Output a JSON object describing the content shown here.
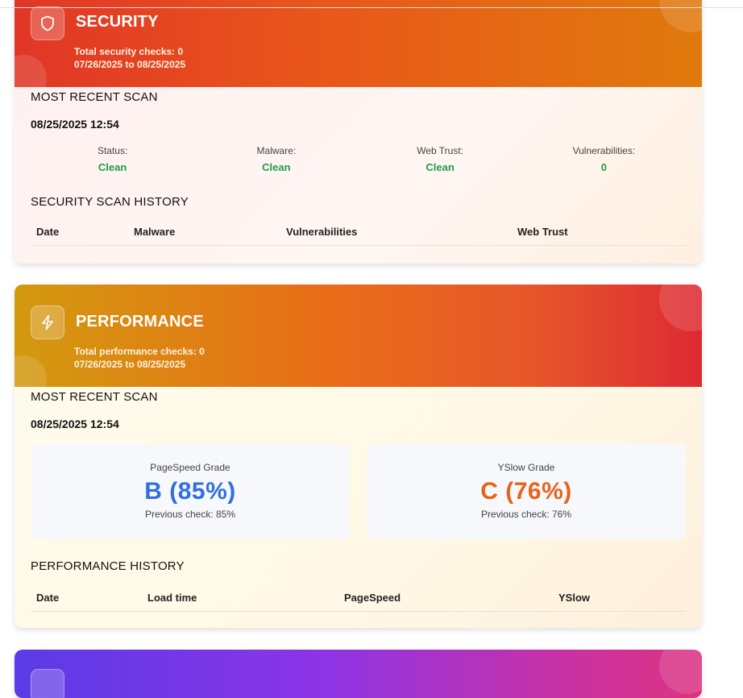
{
  "security": {
    "title": "SECURITY",
    "total_checks": "Total security checks: 0",
    "date_range": "07/26/2025 to 08/25/2025",
    "most_recent_label": "MOST RECENT SCAN",
    "scan_time": "08/25/2025 12:54",
    "stats": [
      {
        "label": "Status:",
        "value": "Clean"
      },
      {
        "label": "Malware:",
        "value": "Clean"
      },
      {
        "label": "Web Trust:",
        "value": "Clean"
      },
      {
        "label": "Vulnerabilities:",
        "value": "0"
      }
    ],
    "history_label": "SECURITY SCAN HISTORY",
    "history_columns": [
      "Date",
      "Malware",
      "Vulnerabilities",
      "Web Trust"
    ]
  },
  "performance": {
    "title": "PERFORMANCE",
    "total_checks": "Total performance checks: 0",
    "date_range": "07/26/2025 to 08/25/2025",
    "most_recent_label": "MOST RECENT SCAN",
    "scan_time": "08/25/2025 12:54",
    "pagespeed": {
      "label": "PageSpeed Grade",
      "value": "B (85%)",
      "previous": "Previous check: 85%",
      "color": "#2f6fe0"
    },
    "yslow": {
      "label": "YSlow Grade",
      "value": "C (76%)",
      "previous": "Previous check: 76%",
      "color": "#e8621a"
    },
    "history_label": "PERFORMANCE HISTORY",
    "history_columns": [
      "Date",
      "Load time",
      "PageSpeed",
      "YSlow"
    ]
  },
  "icons": {
    "security": "shield-icon",
    "performance": "lightning-icon",
    "third": "card-icon"
  },
  "colors": {
    "clean": "#1f9d48",
    "security_gradient": [
      "#e13627",
      "#e07a0d"
    ],
    "performance_gradient": [
      "#d29a0f",
      "#dd2a33"
    ],
    "third_gradient": [
      "#5a3be6",
      "#dc3380"
    ]
  }
}
